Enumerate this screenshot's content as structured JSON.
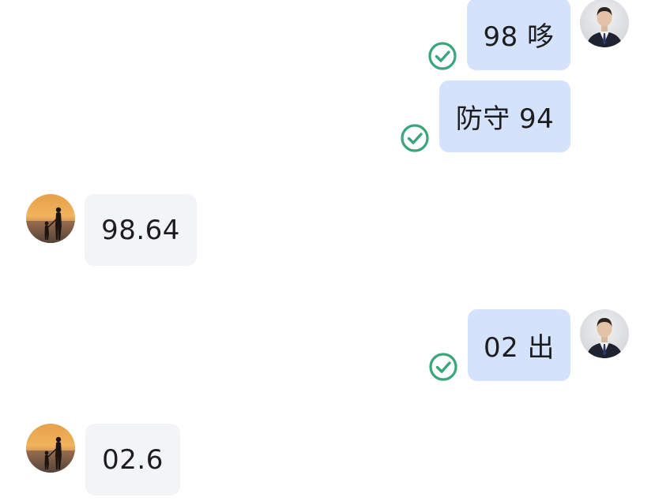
{
  "messages": [
    {
      "direction": "outgoing",
      "text": "98 哆",
      "status": "read-check-icon"
    },
    {
      "direction": "outgoing",
      "text": "防守 94",
      "status": "read-check-icon"
    },
    {
      "direction": "incoming",
      "text": "98.64"
    },
    {
      "direction": "outgoing",
      "text": "02 出",
      "status": "read-check-icon"
    },
    {
      "direction": "incoming",
      "text": "02.6"
    }
  ],
  "colors": {
    "outgoing_bubble": "#d4e2fb",
    "incoming_bubble": "#f3f4f6",
    "check": "#3aa57a",
    "text": "#1d1d1f"
  },
  "icons": {
    "self_avatar": "man-in-suit-avatar",
    "other_avatar": "sunset-silhouette-avatar",
    "status": "read-check-icon"
  }
}
